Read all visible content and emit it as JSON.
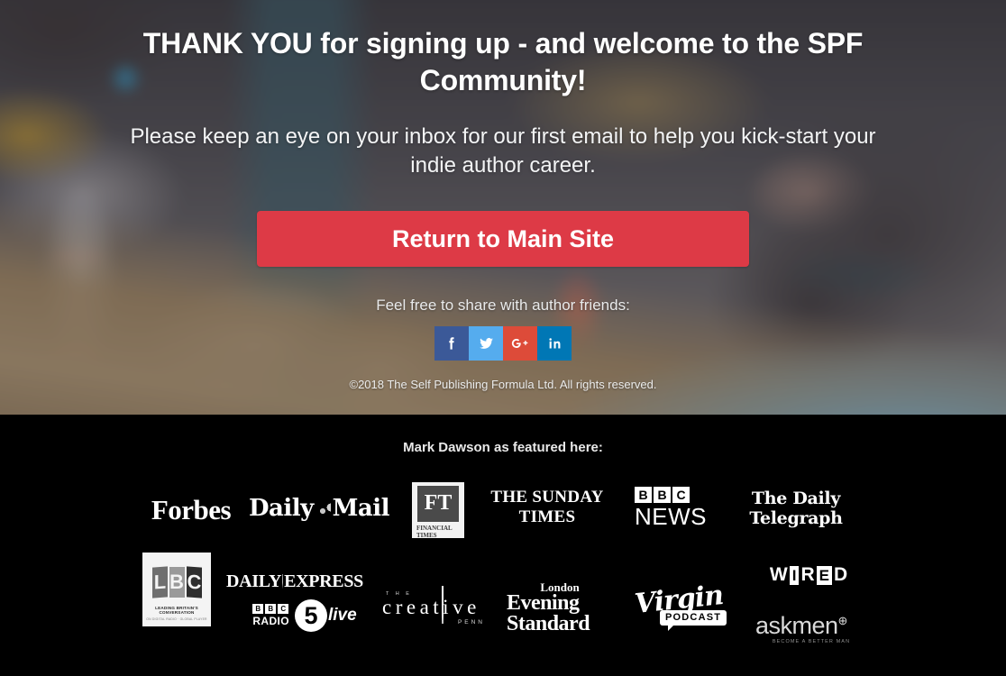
{
  "hero": {
    "title": "THANK YOU for signing up - and welcome to the SPF Community!",
    "subtitle": "Please keep an eye on your inbox for our first email to help you kick-start your indie author career.",
    "cta_label": "Return to Main Site",
    "share_label": "Feel free to share with author friends:",
    "copyright": "©2018 The Self Publishing Formula Ltd. All rights reserved.",
    "cta_color": "#dd3a46",
    "social": [
      {
        "name": "facebook-share-button",
        "icon": "facebook-icon",
        "color": "#3b5998"
      },
      {
        "name": "twitter-share-button",
        "icon": "twitter-icon",
        "color": "#55acee"
      },
      {
        "name": "googleplus-share-button",
        "icon": "google-plus-icon",
        "color": "#dd4b39"
      },
      {
        "name": "linkedin-share-button",
        "icon": "linkedin-icon",
        "color": "#0077b5"
      }
    ]
  },
  "featured": {
    "title": "Mark Dawson as featured here:",
    "background": "#000000",
    "logos": [
      {
        "id": "forbes",
        "text": "Forbes"
      },
      {
        "id": "daily-mail",
        "text_1": "Daily",
        "text_2": "Mail"
      },
      {
        "id": "financial-times",
        "mark": "FT",
        "caption_1": "FINANCIAL",
        "caption_2": "TIMES"
      },
      {
        "id": "sunday-times",
        "text": "THE SUNDAY TIMES"
      },
      {
        "id": "bbc-news",
        "letters": [
          "B",
          "B",
          "C"
        ],
        "text": "NEWS"
      },
      {
        "id": "daily-telegraph",
        "text": "The Daily Telegraph"
      },
      {
        "id": "lbc",
        "letters": [
          "L",
          "B",
          "C"
        ],
        "tagline": "LEADING BRITAIN'S CONVERSATION",
        "subline": "ON DIGITAL RADIO · GLOBAL PLAYER"
      },
      {
        "id": "daily-express",
        "text_1": "DAILY",
        "text_2": "EXPRESS"
      },
      {
        "id": "bbc-radio-5-live",
        "letters": [
          "B",
          "B",
          "C"
        ],
        "radio": "RADIO",
        "number": "5",
        "live": "live"
      },
      {
        "id": "the-creative-penn",
        "the": "T H E",
        "word": "creative",
        "penn": "PENN"
      },
      {
        "id": "london-evening-standard",
        "line_1": "London",
        "line_2": "Evening",
        "line_3": "Standard"
      },
      {
        "id": "virgin-podcast",
        "word": "Virgin",
        "badge": "PODCAST"
      },
      {
        "id": "wired",
        "chars": [
          "W",
          "I",
          "R",
          "E",
          "D"
        ],
        "inverted": [
          1,
          3
        ]
      },
      {
        "id": "askmen",
        "word": "askmen",
        "plus": "⊕",
        "tagline": "BECOME A BETTER MAN"
      }
    ]
  }
}
